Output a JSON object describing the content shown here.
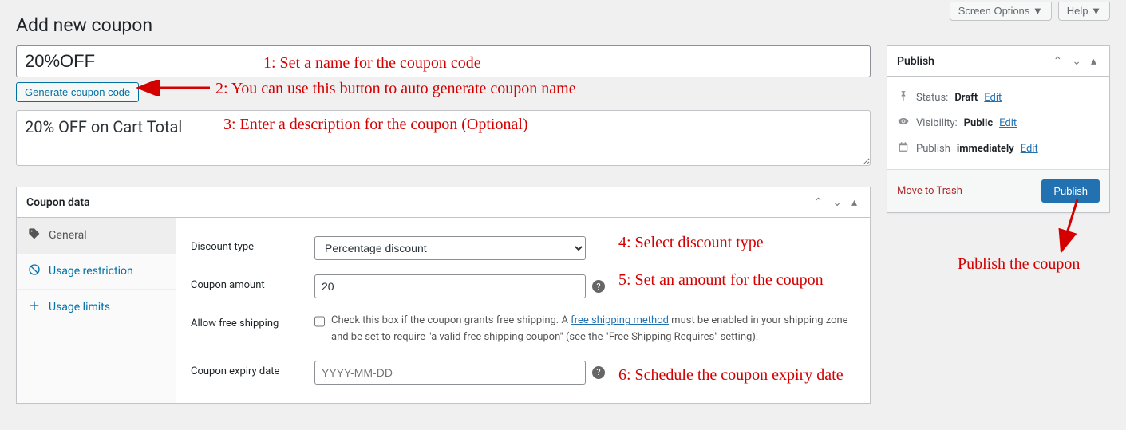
{
  "top": {
    "screen_options": "Screen Options ▼",
    "help": "Help ▼"
  },
  "page_title": "Add new coupon",
  "coupon_title_value": "20%OFF",
  "generate_btn": "Generate coupon code",
  "description_value": "20% OFF on Cart Total",
  "coupon_data": {
    "header": "Coupon data",
    "tabs": {
      "general": "General",
      "restriction": "Usage restriction",
      "limits": "Usage limits"
    },
    "fields": {
      "discount_type_label": "Discount type",
      "discount_type_value": "Percentage discount",
      "coupon_amount_label": "Coupon amount",
      "coupon_amount_value": "20",
      "allow_free_shipping_label": "Allow free shipping",
      "free_ship_text_1": "Check this box if the coupon grants free shipping. A ",
      "free_ship_link": "free shipping method",
      "free_ship_text_2": " must be enabled in your shipping zone and be set to require \"a valid free shipping coupon\" (see the \"Free Shipping Requires\" setting).",
      "expiry_label": "Coupon expiry date",
      "expiry_placeholder": "YYYY-MM-DD"
    }
  },
  "publish": {
    "header": "Publish",
    "status_label": "Status:",
    "status_value": "Draft",
    "visibility_label": "Visibility:",
    "visibility_value": "Public",
    "schedule_label_1": "Publish",
    "schedule_label_2": "immediately",
    "edit": "Edit",
    "trash": "Move to Trash",
    "publish_btn": "Publish"
  },
  "annotations": {
    "a1": "1: Set a name for the coupon code",
    "a2": "2: You can use this button to auto generate coupon name",
    "a3": "3: Enter a description for the coupon (Optional)",
    "a4": "4: Select discount type",
    "a5": "5: Set an amount for the coupon",
    "a6": "6: Schedule the coupon expiry date",
    "a7": "Publish the coupon"
  }
}
